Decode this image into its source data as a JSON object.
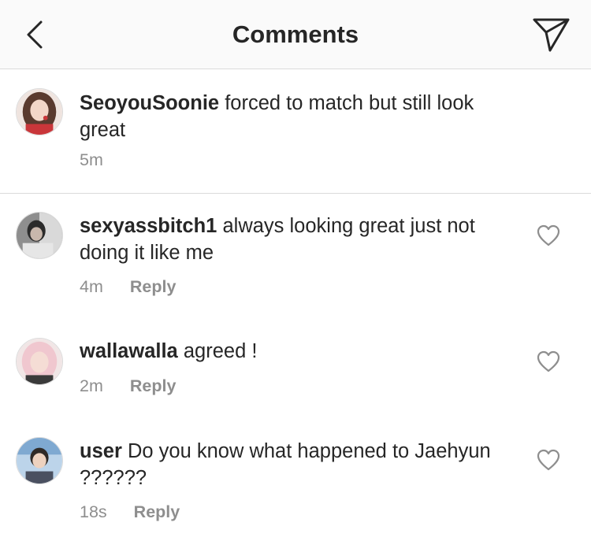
{
  "header": {
    "title": "Comments",
    "back_icon": "chevron-left-icon",
    "share_icon": "paper-plane-icon"
  },
  "caption": {
    "username": "SeoyouSoonie",
    "text": "forced to match but still look great",
    "time": "5m"
  },
  "comments": [
    {
      "username": "sexyassbitch1",
      "text": "always looking great just not doing it like me",
      "time": "4m",
      "reply_label": "Reply"
    },
    {
      "username": "wallawalla",
      "text": "agreed !",
      "time": "2m",
      "reply_label": "Reply"
    },
    {
      "username": "user",
      "text": "Do you know what happened to Jaehyun ??????",
      "time": "18s",
      "reply_label": "Reply"
    }
  ],
  "colors": {
    "text": "#262626",
    "secondary": "#8e8e8e",
    "divider": "#dbdbdb",
    "header_bg": "#fafafa"
  }
}
